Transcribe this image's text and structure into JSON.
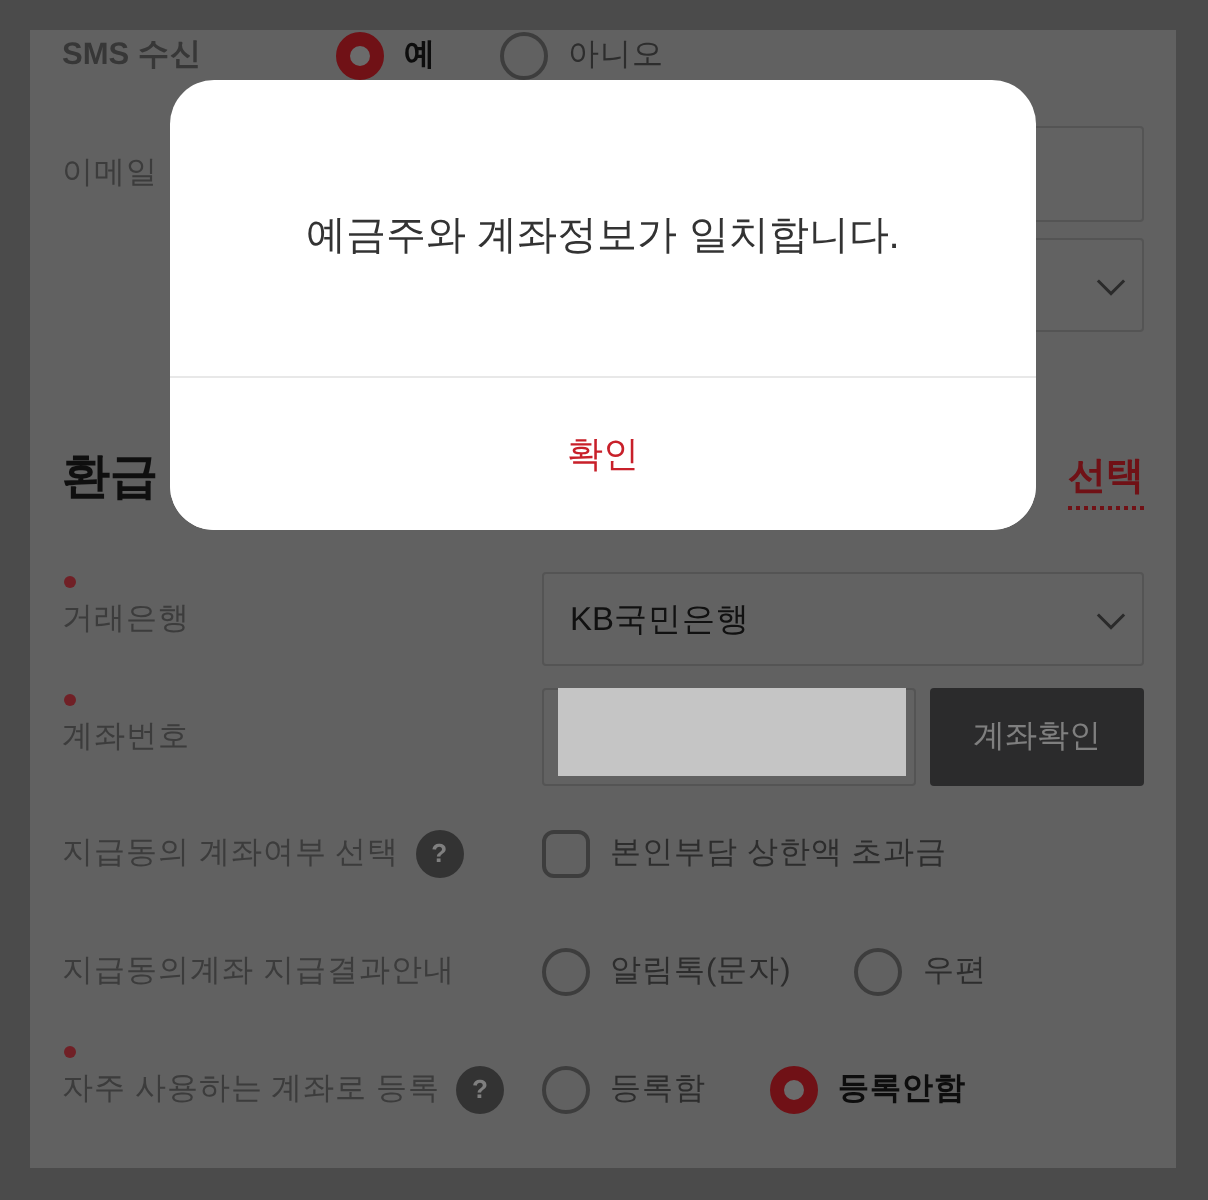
{
  "contact": {
    "sms": {
      "label": "SMS 수신",
      "options": [
        {
          "label": "예",
          "selected": true
        },
        {
          "label": "아니오",
          "selected": false
        }
      ]
    },
    "email": {
      "label": "이메일"
    }
  },
  "refund_section": {
    "title": "환급",
    "link": "선택",
    "fields": [
      {
        "kind": "select",
        "label": "거래은행",
        "required": true,
        "value": "KB국민은행"
      },
      {
        "kind": "account",
        "label": "계좌번호",
        "required": true,
        "button": "계좌확인"
      },
      {
        "kind": "checkbox",
        "label": "지급동의 계좌여부 선택",
        "help": "?",
        "required": false,
        "options": [
          {
            "label": "본인부담 상한액 초과금",
            "checked": false
          }
        ]
      },
      {
        "kind": "radio",
        "label": "지급동의계좌 지급결과안내",
        "required": false,
        "options": [
          {
            "label": "알림톡(문자)",
            "selected": false
          },
          {
            "label": "우편",
            "selected": false
          }
        ]
      },
      {
        "kind": "radio",
        "label": "자주 사용하는 계좌로 등록",
        "help": "?",
        "required": true,
        "options": [
          {
            "label": "등록함",
            "selected": false
          },
          {
            "label": "등록안함",
            "selected": true
          }
        ]
      }
    ]
  },
  "dialog": {
    "message": "예금주와 계좌정보가 일치합니다.",
    "button": "확인"
  }
}
